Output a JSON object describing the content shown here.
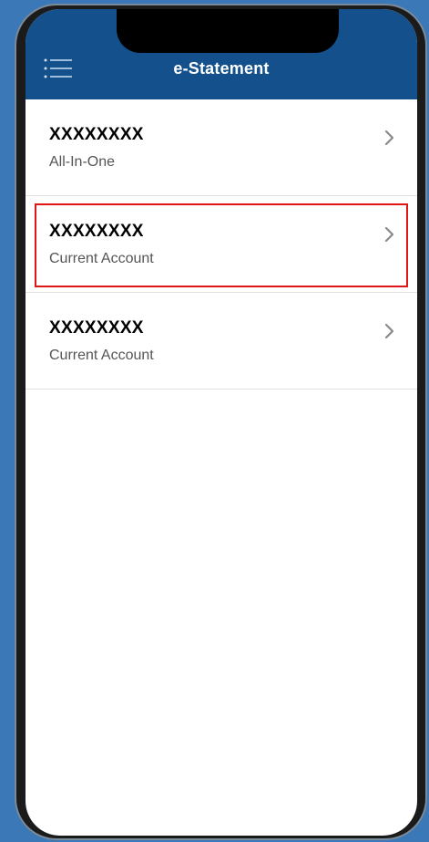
{
  "header": {
    "title": "e-Statement",
    "menu_icon": "hamburger-menu-icon",
    "background_color": "#14508b"
  },
  "accounts": [
    {
      "number": "XXXXXXXX",
      "type": "All-In-One",
      "highlighted": false
    },
    {
      "number": "XXXXXXXX",
      "type": "Current Account",
      "highlighted": true
    },
    {
      "number": "XXXXXXXX",
      "type": "Current Account",
      "highlighted": false
    }
  ],
  "highlight_color": "#e01515"
}
